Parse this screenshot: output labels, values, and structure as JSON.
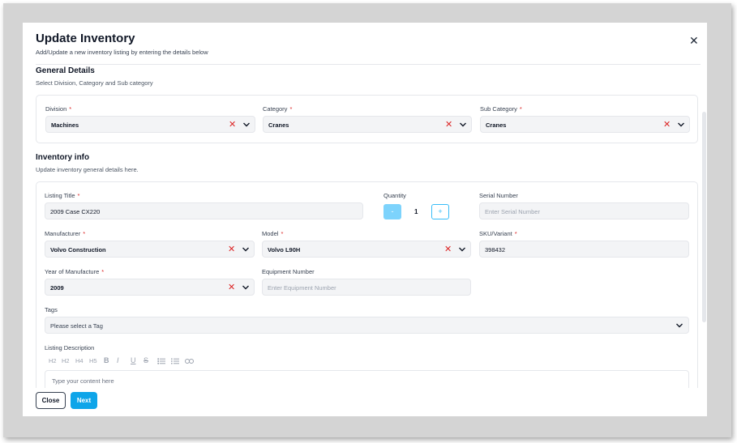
{
  "modal": {
    "title": "Update Inventory",
    "subtitle": "Add/Update a new inventory listing by entering the details below",
    "close_icon": "close-icon"
  },
  "general": {
    "title": "General Details",
    "subtitle": "Select Division, Category and Sub category",
    "division": {
      "label": "Division",
      "required": "*",
      "value": "Machines"
    },
    "category": {
      "label": "Category",
      "required": "*",
      "value": "Cranes"
    },
    "sub_category": {
      "label": "Sub Category",
      "required": "*",
      "value": "Cranes"
    }
  },
  "inventory": {
    "title": "Inventory info",
    "subtitle": "Update inventory general details here.",
    "listing_title": {
      "label": "Listing Title",
      "required": "*",
      "value": "2009 Case CX220"
    },
    "quantity": {
      "label": "Quantity",
      "value": "1",
      "minus": "-",
      "plus": "+"
    },
    "serial_number": {
      "label": "Serial Number",
      "placeholder": "Enter Serial Number"
    },
    "manufacturer": {
      "label": "Manufacturer",
      "required": "*",
      "value": "Volvo Construction"
    },
    "model": {
      "label": "Model",
      "required": "*",
      "value": "Volvo L90H"
    },
    "sku": {
      "label": "SKU/Variant",
      "required": "*",
      "value": "398432"
    },
    "year": {
      "label": "Year of Manufacture",
      "required": "*",
      "value": "2009"
    },
    "equipment_number": {
      "label": "Equipment Number",
      "placeholder": "Enter Equipment Number"
    },
    "tags": {
      "label": "Tags",
      "placeholder": "Please select a Tag"
    },
    "description": {
      "label": "Listing Description",
      "toolbar": [
        "H2",
        "H2",
        "H4",
        "H5",
        "B",
        "I",
        "U",
        "S",
        "list-bullet",
        "list-ordered",
        "link"
      ],
      "placeholder": "Type your content here"
    }
  },
  "footer": {
    "close_label": "Close",
    "next_label": "Next"
  },
  "colors": {
    "accent": "#0ea5e9",
    "required": "#dc2626",
    "clear": "#dc2626"
  }
}
